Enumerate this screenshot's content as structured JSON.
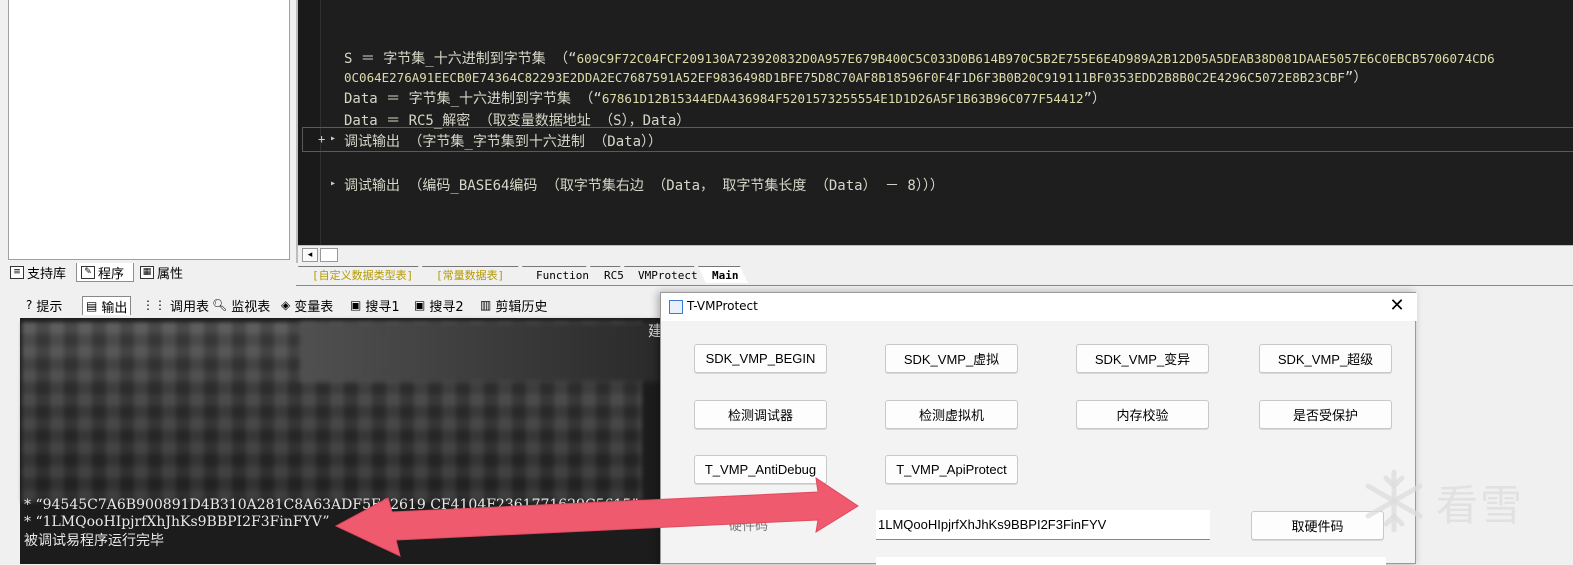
{
  "left_panel": {
    "tabs": [
      {
        "label": "支持库",
        "icon": "library-icon"
      },
      {
        "label": "程序",
        "icon": "program-icon",
        "active": true
      },
      {
        "label": "属性",
        "icon": "property-icon"
      }
    ]
  },
  "editor": {
    "lines": {
      "s_line_1_prefix": "S ＝ 字节集_十六进制到字节集 （“",
      "s_line_1_hex": "609C9F72C04FCF209130A723920832D0A957E679B400C5C033D0B614B970C5B2E755E6E4D989A2B12D05A5DEAB38D081DAAE5057E6C0EBCB5706074CD6",
      "s_line_2_hex": "0C064E276A91EECB0E74364C82293E2DDA2EC7687591A52EF9836498D1BFE75D8C70AF8B18596F0F4F1D6F3B0B20C919111BF0353EDD2B8B0C2E4296C5072E8B23CBF",
      "s_line_2_suffix": "”）",
      "data1_prefix": "Data ＝ 字节集_十六进制到字节集 （“",
      "data1_hex": "67861D12B15344EDA436984F5201573255554E1D1D26A5F1B63B96C077F54412",
      "data1_suffix": "”）",
      "data2": "Data ＝ RC5_解密 （取变量数据地址 （S），Data）",
      "debug1": "调试输出 （字节集_字节集到十六进制 （Data））",
      "debug2": "调试输出 （编码_BASE64编码 （取字节集右边 （Data， 取字节集长度 （Data） － 8）））"
    },
    "markers": {
      "plus": "+",
      "arrow": "▸"
    }
  },
  "editor_tabs": [
    "[自定义数据类型表]",
    "[常量数据表]",
    "Function",
    "RC5",
    "VMProtect",
    "Main"
  ],
  "active_editor_tab": "Main",
  "bottom_toolbar": {
    "items": [
      {
        "label": "提示",
        "icon": "hint-icon"
      },
      {
        "label": "输出",
        "icon": "output-icon",
        "active": true
      },
      {
        "label": "调用表",
        "icon": "call-table-icon"
      },
      {
        "label": "监视表",
        "icon": "watch-icon"
      },
      {
        "label": "变量表",
        "icon": "variable-icon"
      },
      {
        "label": "搜寻1",
        "icon": "search1-icon"
      },
      {
        "label": "搜寻2",
        "icon": "search2-icon"
      },
      {
        "label": "剪辑历史",
        "icon": "clip-history-icon"
      }
    ]
  },
  "output": {
    "line1": "*  “94545C7A6B900891D4B310A281C8A63ADF5E12619 CF4104F2361771629C5615”",
    "line2": "*  “1LMQooHIpjrfXhJhKs9BBPI2F3FinFYV”",
    "line3": "被调试易程序运行完毕",
    "partial_right": "建"
  },
  "dialog": {
    "title": "T-VMProtect",
    "close": "✕",
    "buttons": {
      "vmp_begin": "SDK_VMP_BEGIN",
      "vmp_virtual": "SDK_VMP_虚拟",
      "vmp_mutate": "SDK_VMP_变异",
      "vmp_super": "SDK_VMP_超级",
      "detect_debugger": "检测调试器",
      "detect_vm": "检测虚拟机",
      "memory_check": "内存校验",
      "is_protected": "是否受保护",
      "anti_debug": "T_VMP_AntiDebug",
      "api_protect": "T_VMP_ApiProtect",
      "get_hwid": "取硬件码"
    },
    "code_label": "硬件码",
    "code_value": "1LMQooHIpjrfXhJhKs9BBPI2F3FinFYV"
  },
  "watermark": {
    "text": "看雪",
    "icon": "snowflake-icon"
  },
  "colors": {
    "arrow": "#f05a6e",
    "editor_bg": "#1e1e1e",
    "hex_string": "#dcdcaa"
  }
}
